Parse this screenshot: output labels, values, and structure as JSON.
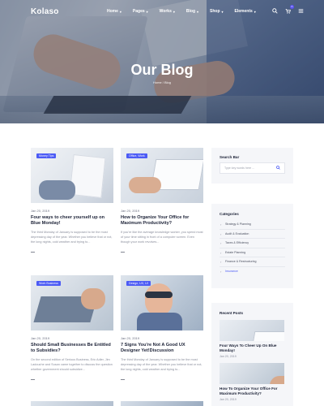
{
  "header": {
    "logo": "Kolaso",
    "nav": [
      {
        "label": "Home",
        "dropdown": true
      },
      {
        "label": "Pages",
        "dropdown": true
      },
      {
        "label": "Works",
        "dropdown": true
      },
      {
        "label": "Blog",
        "dropdown": true
      },
      {
        "label": "Shop",
        "dropdown": true
      },
      {
        "label": "Elements",
        "dropdown": true
      }
    ],
    "icons": {
      "search": "search-icon",
      "cart": "cart-icon",
      "menu": "menu-icon"
    },
    "cart_count": "0"
  },
  "hero": {
    "title": "Our Blog",
    "breadcrumb": "Home / Blog"
  },
  "posts": [
    {
      "category": "Money Tips",
      "date": "Jan 20, 2019",
      "title": "Four ways to cheer yourself up on Blue Monday!",
      "excerpt": "The third Monday of January is supposed to be the most depressing day of the year. Whether you believe that or not, the long nights, cold weather and trying to...",
      "more": "—"
    },
    {
      "category": "Office, Work",
      "date": "Jan 20, 2019",
      "title": "How to Organize Your Office for Maximum Productivity?",
      "excerpt": "If you're like the average knowledge worker, you spend most of your time sitting in front of a computer screen. Even though your work revolves...",
      "more": "—"
    },
    {
      "category": "Work Business",
      "date": "Jan 20, 2019",
      "title": "Should Small Businesses Be Entitled to Subsidies?",
      "excerpt": "On the second edition of Serious Business, Eric Adler, Jim Ladouche and Susan came together to discuss the question whether government should subsidize...",
      "more": "—"
    },
    {
      "category": "Design, UX, UI",
      "date": "Jan 20, 2019",
      "title": "7 Signs You're Not A Good UX Designer Yet!Discussion",
      "excerpt": "The third Monday of January is supposed to be the most depressing day of the year. Whether you believe that or not, the long nights, cold weather and trying to...",
      "more": "—"
    }
  ],
  "sidebar": {
    "search": {
      "title": "Search Bar",
      "placeholder": "Type key words here ...",
      "icon": "search-icon"
    },
    "categories": {
      "title": "Categories",
      "items": [
        "Strategy & Planning",
        "Audit & Evaluation",
        "Taxes & Efficiency",
        "Estate Planning",
        "Finance & Restructuring",
        "Insurance"
      ],
      "active_index": 5
    },
    "recent": {
      "title": "Recent Posts",
      "items": [
        {
          "title": "Four Ways To Cheer Up On Blue Monday!",
          "date": "Jan 20, 2019"
        },
        {
          "title": "How To Organize Your Office For Maximum Productivity?",
          "date": "Jan 20, 2019"
        }
      ]
    }
  },
  "colors": {
    "accent": "#4c5bf5",
    "heading": "#1c2237",
    "muted": "#8a8e9c",
    "sidebar_bg": "#f5f6f9"
  }
}
